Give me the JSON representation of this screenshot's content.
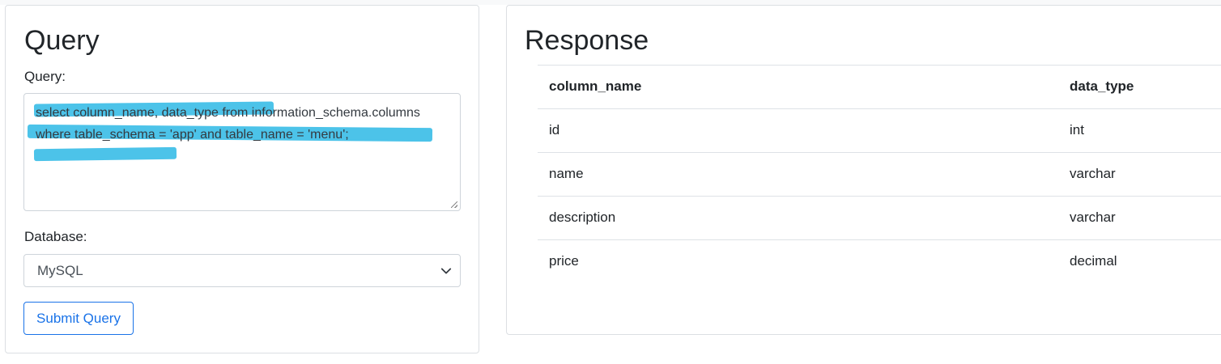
{
  "query_panel": {
    "title": "Query",
    "query_label": "Query:",
    "query_text": "select column_name, data_type from information_schema.columns where table_schema = 'app' and table_name = 'menu';",
    "database_label": "Database:",
    "database_selected": "MySQL",
    "submit_label": "Submit Query",
    "highlight_color": "#42c0e8"
  },
  "response_panel": {
    "title": "Response",
    "columns": [
      "column_name",
      "data_type"
    ],
    "rows": [
      [
        "id",
        "int"
      ],
      [
        "name",
        "varchar"
      ],
      [
        "description",
        "varchar"
      ],
      [
        "price",
        "decimal"
      ]
    ]
  }
}
